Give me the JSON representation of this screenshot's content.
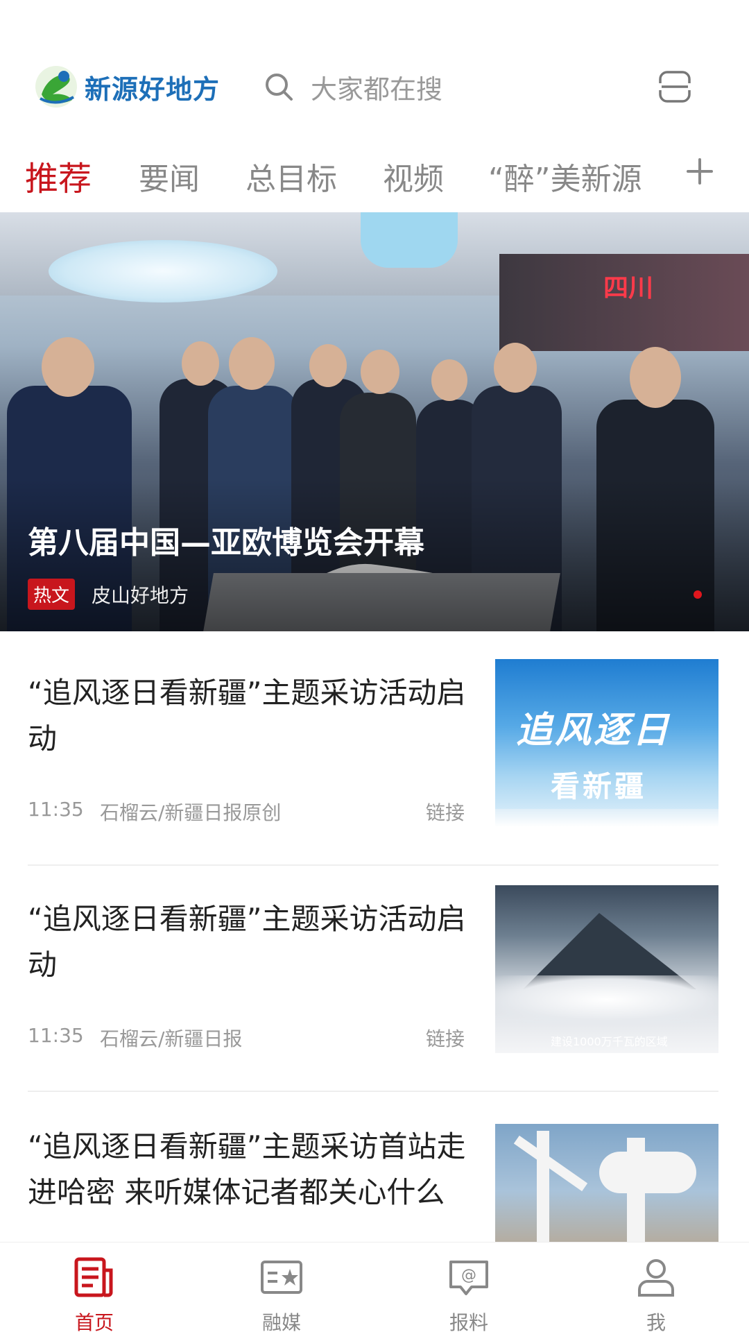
{
  "header": {
    "logo_text": "新源好地方",
    "search_placeholder": "大家都在搜",
    "icons": {
      "search": "search-icon",
      "scan": "scan-icon"
    }
  },
  "tabs": [
    {
      "label": "推荐",
      "active": true
    },
    {
      "label": "要闻",
      "active": false
    },
    {
      "label": "总目标",
      "active": false
    },
    {
      "label": "视频",
      "active": false
    },
    {
      "label": "“醉”美新源",
      "active": false
    }
  ],
  "tabs_more_icon": "plus-icon",
  "hero": {
    "title": "第八届中国—亚欧博览会开幕",
    "badge": "热文",
    "source": "皮山好地方",
    "booth_text": "四川"
  },
  "news": [
    {
      "title": "“追风逐日看新疆”主题采访活动启动",
      "time": "11:35",
      "source": "石榴云/新疆日报原创",
      "link": "链接",
      "thumb_text": "追风逐日",
      "thumb_sub": "看新疆"
    },
    {
      "title": "“追风逐日看新疆”主题采访活动启动",
      "time": "11:35",
      "source": "石榴云/新疆日报",
      "link": "链接",
      "thumb_caption": "建设1000万千瓦的区域"
    },
    {
      "title": "“追风逐日看新疆”主题采访首站走进哈密 来听媒体记者都关心什么"
    }
  ],
  "bottom_nav": [
    {
      "label": "首页",
      "icon": "news-icon",
      "active": true
    },
    {
      "label": "融媒",
      "icon": "media-card-icon",
      "active": false
    },
    {
      "label": "报料",
      "icon": "report-chat-icon",
      "active": false
    },
    {
      "label": "我",
      "icon": "user-icon",
      "active": false
    }
  ],
  "colors": {
    "accent": "#c8161d",
    "brand_blue": "#1d6fb8",
    "muted": "#999999"
  }
}
